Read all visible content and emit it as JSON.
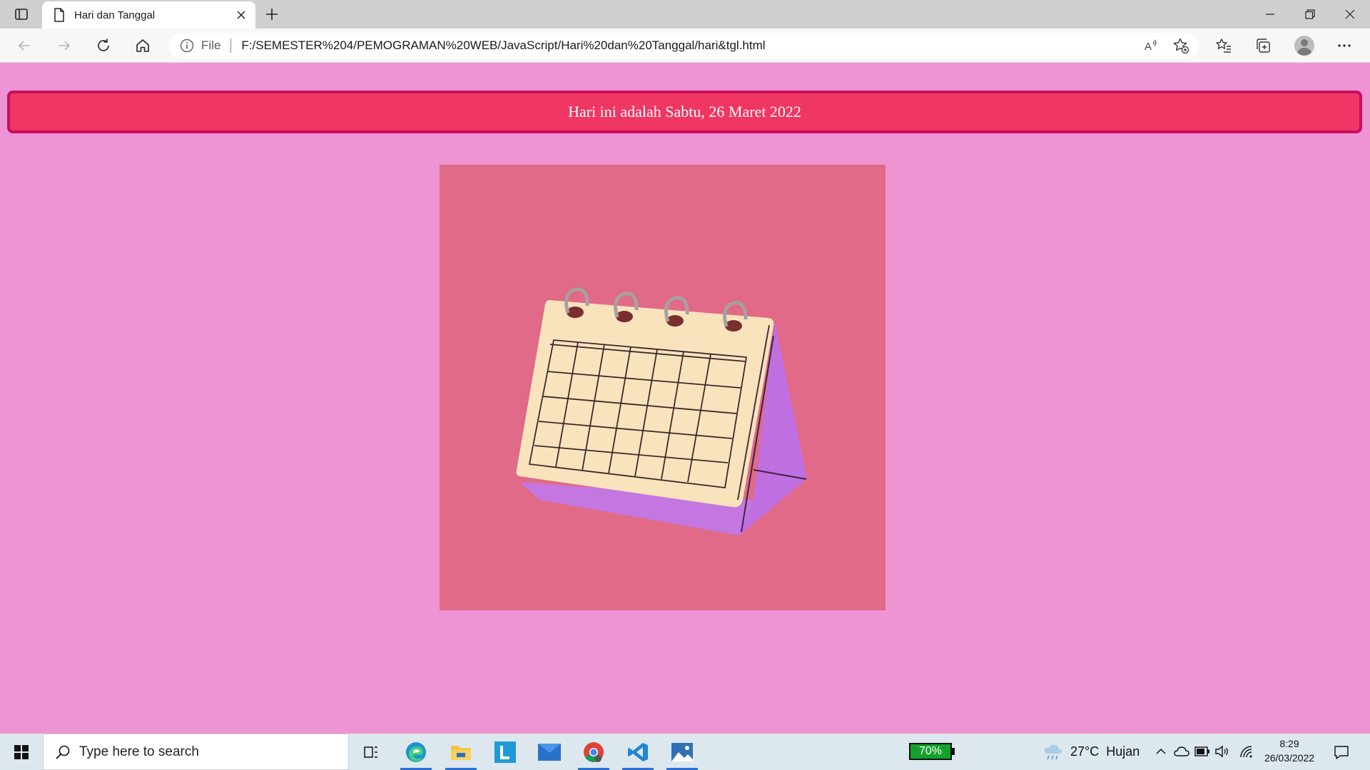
{
  "browser": {
    "tab": {
      "title": "Hari dan Tanggal",
      "favicon": "page-icon"
    },
    "address": {
      "scheme_label": "File",
      "url": "F:/SEMESTER%204/PEMOGRAMAN%20WEB/JavaScript/Hari%20dan%20Tanggal/hari&tgl.html"
    }
  },
  "page": {
    "banner_text": "Hari ini adalah Sabtu, 26 Maret 2022",
    "image": {
      "subject": "calendar-illustration"
    },
    "colors": {
      "background": "#ee94d3",
      "banner_fill": "#f03663",
      "banner_border": "#c80d60",
      "image_background": "#e06a87"
    }
  },
  "taskbar": {
    "search_placeholder": "Type here to search",
    "battery_percent": "70%",
    "weather": {
      "temperature": "27°C",
      "condition": "Hujan"
    },
    "clock": {
      "time": "8:29",
      "date": "26/03/2022"
    },
    "apps": [
      "task-view",
      "edge",
      "file-explorer",
      "l-app",
      "mail",
      "chrome",
      "vscode",
      "photos"
    ]
  }
}
